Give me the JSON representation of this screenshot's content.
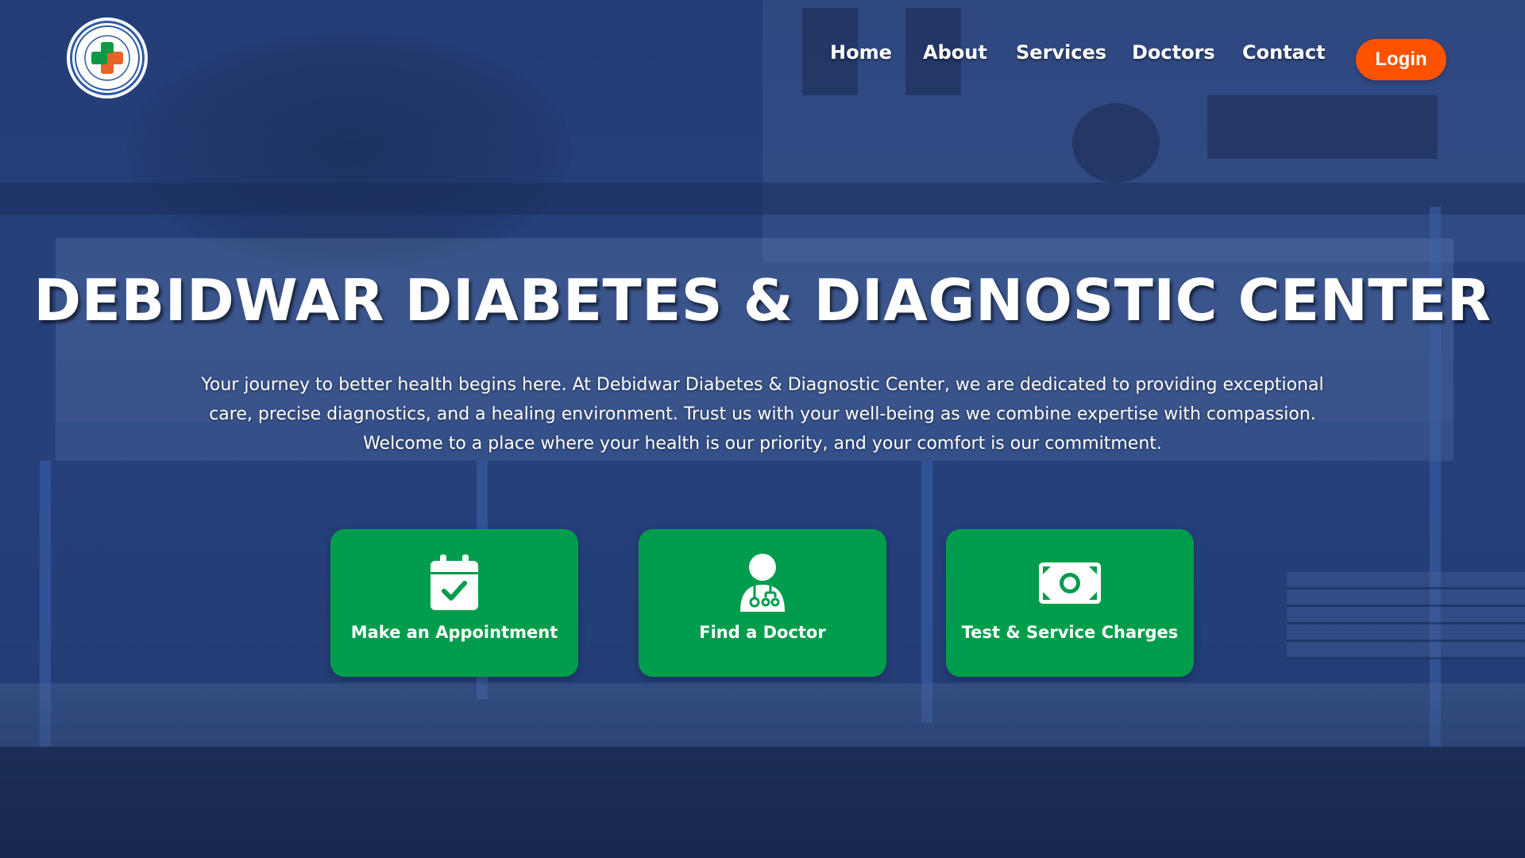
{
  "nav": {
    "logo_icon": "medical-cross-logo",
    "links": [
      "Home",
      "About",
      "Services",
      "Doctors",
      "Contact"
    ],
    "login_label": "Login"
  },
  "hero": {
    "title": "DEBIDWAR DIABETES & DIAGNOSTIC CENTER",
    "description_lines": [
      "Your journey to better health begins here. At Debidwar Diabetes & Diagnostic Center, we are dedicated to providing exceptional",
      "care, precise diagnostics, and a healing environment. Trust us with your well-being as we combine expertise with compassion.",
      "Welcome to a place where your health is our priority, and your comfort is our commitment."
    ]
  },
  "cards": [
    {
      "label": "Make an Appointment",
      "icon": "calendar-check-icon"
    },
    {
      "label": "Find a Doctor",
      "icon": "doctor-icon"
    },
    {
      "label": "Test & Service Charges",
      "icon": "money-bill-icon"
    }
  ],
  "colors": {
    "overlay": "#2d4a80",
    "card": "#019d4c",
    "login": "#ff5200",
    "text": "#ffffff"
  }
}
